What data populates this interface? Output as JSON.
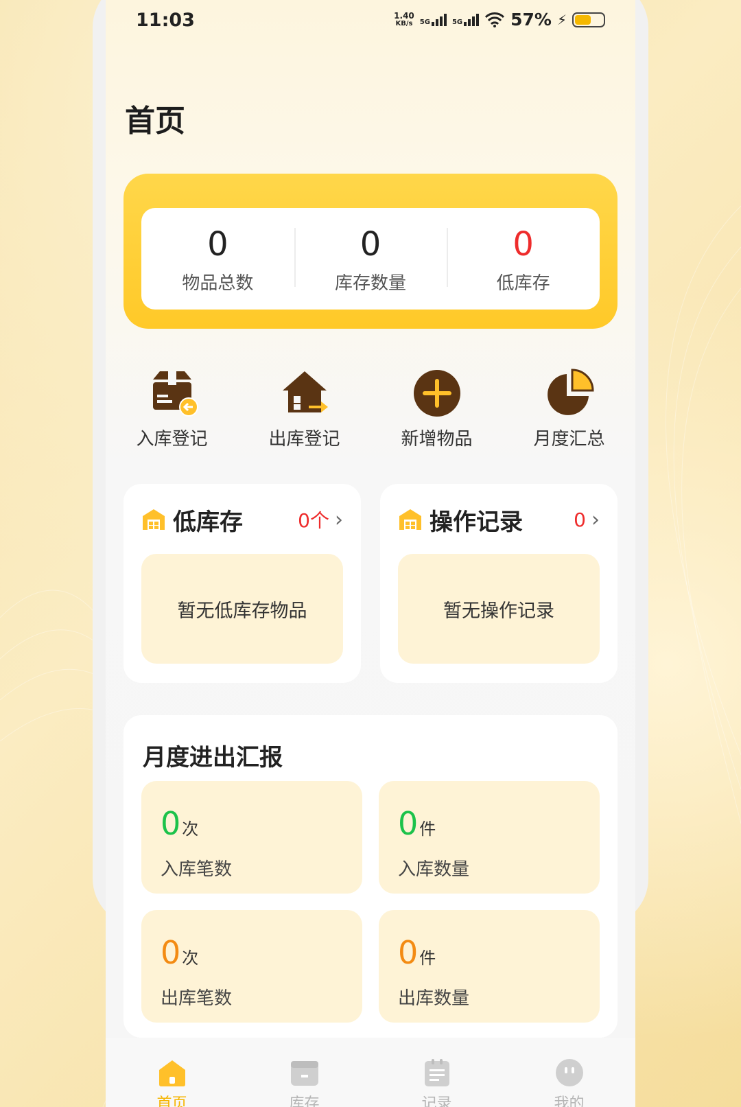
{
  "status_bar": {
    "time": "11:03",
    "net_speed_value": "1.40",
    "net_speed_unit": "KB/s",
    "signal_1": "5G",
    "signal_2": "5G",
    "battery": "57%"
  },
  "page": {
    "title": "首页"
  },
  "summary": {
    "items": [
      {
        "value": "0",
        "label": "物品总数"
      },
      {
        "value": "0",
        "label": "库存数量"
      },
      {
        "value": "0",
        "label": "低库存"
      }
    ]
  },
  "actions": [
    {
      "label": "入库登记",
      "icon": "inbound-box-icon"
    },
    {
      "label": "出库登记",
      "icon": "outbound-house-icon"
    },
    {
      "label": "新增物品",
      "icon": "add-circle-icon"
    },
    {
      "label": "月度汇总",
      "icon": "pie-chart-icon"
    }
  ],
  "low_stock": {
    "title": "低库存",
    "count": "0个",
    "empty": "暂无低库存物品"
  },
  "op_records": {
    "title": "操作记录",
    "count": "0",
    "empty": "暂无操作记录"
  },
  "report": {
    "title": "月度进出汇报",
    "tiles": [
      {
        "value": "0",
        "unit": "次",
        "label": "入库笔数"
      },
      {
        "value": "0",
        "unit": "件",
        "label": "入库数量"
      },
      {
        "value": "0",
        "unit": "次",
        "label": "出库笔数"
      },
      {
        "value": "0",
        "unit": "件",
        "label": "出库数量"
      }
    ]
  },
  "tabs": [
    {
      "label": "首页"
    },
    {
      "label": "库存"
    },
    {
      "label": "记录"
    },
    {
      "label": "我的"
    }
  ],
  "colors": {
    "accent": "#ffc928",
    "brown": "#5a3413",
    "red": "#ee2c2c",
    "green": "#1cc24a",
    "orange": "#f38b13"
  }
}
